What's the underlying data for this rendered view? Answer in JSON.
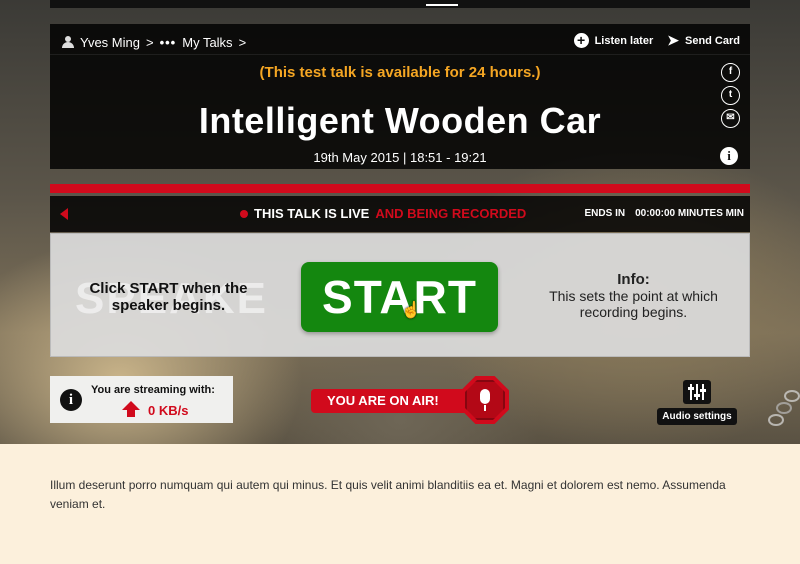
{
  "breadcrumb": {
    "user": "Yves Ming",
    "sep": ">",
    "ellipsis": "•••",
    "section": "My Talks"
  },
  "header_actions": {
    "listen_later": "Listen later",
    "send_card": "Send Card"
  },
  "talk": {
    "availability": "(This test talk is available for 24 hours.)",
    "title": "Intelligent Wooden Car",
    "date": "19th May 2015 | 18:51 - 19:21"
  },
  "social": {
    "facebook": "f",
    "twitter": "t",
    "email": "✉"
  },
  "live_bar": {
    "live_label": "THIS TALK IS LIVE",
    "recorded_label": "AND BEING RECORDED",
    "ends_label": "ENDS IN",
    "countdown": "00:00:00 MINUTES MIN"
  },
  "control": {
    "instruction": "Click START when the speaker begins.",
    "start_label": "START",
    "info_title": "Info:",
    "info_text": "This sets the point at which recording begins.",
    "watermark": "SPEAKE"
  },
  "stream": {
    "label": "You are streaming with:",
    "value": "0 KB/s"
  },
  "on_air": {
    "label": "YOU ARE ON AIR!"
  },
  "audio": {
    "label": "Audio settings"
  },
  "footer": {
    "text": "Illum deserunt porro numquam qui autem qui minus. Et quis velit animi blanditiis ea et. Magni et dolorem est nemo. Assumenda veniam et."
  },
  "colors": {
    "accent_red": "#d10a1c",
    "start_green": "#14870f",
    "availability_orange": "#f5a623",
    "page_bg": "#fcf0dc"
  },
  "icons": [
    "user-icon",
    "plus-circle-icon",
    "paper-plane-icon",
    "facebook-icon",
    "twitter-icon",
    "email-icon",
    "info-icon",
    "speaker-icon",
    "live-dot-icon",
    "hand-cursor-icon",
    "upload-arrow-icon",
    "microphone-icon",
    "sliders-icon"
  ]
}
